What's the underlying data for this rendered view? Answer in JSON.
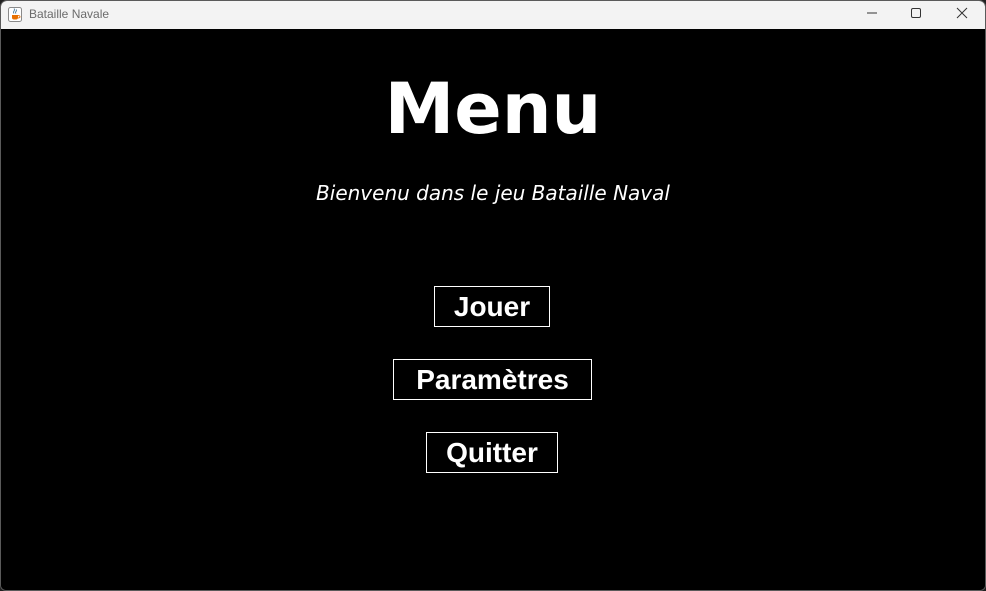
{
  "window": {
    "title": "Bataille Navale",
    "app_icon": "java-cup-icon",
    "controls": {
      "minimize_icon": "minimize-icon",
      "maximize_icon": "maximize-icon",
      "close_icon": "close-icon"
    }
  },
  "menu": {
    "title": "Menu",
    "subtitle": "Bienvenu dans le jeu Bataille Naval",
    "buttons": {
      "play": "Jouer",
      "settings": "Paramètres",
      "quit": "Quitter"
    }
  },
  "colors": {
    "background": "#000000",
    "text": "#ffffff",
    "titlebar": "#f3f3f3",
    "button_border": "#ffffff"
  }
}
